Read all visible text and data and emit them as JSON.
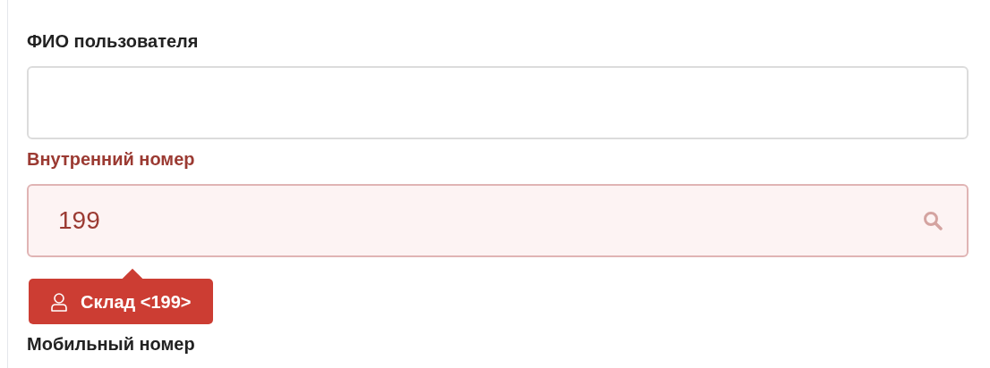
{
  "fields": [
    {
      "label": "ФИО пользователя",
      "error": false,
      "search": false
    },
    {
      "label": "Внутренний номер",
      "value": "199",
      "error": true,
      "search": true,
      "hint": {
        "text": "Склад <199>"
      }
    },
    {
      "label": "Мобильный номер"
    }
  ]
}
